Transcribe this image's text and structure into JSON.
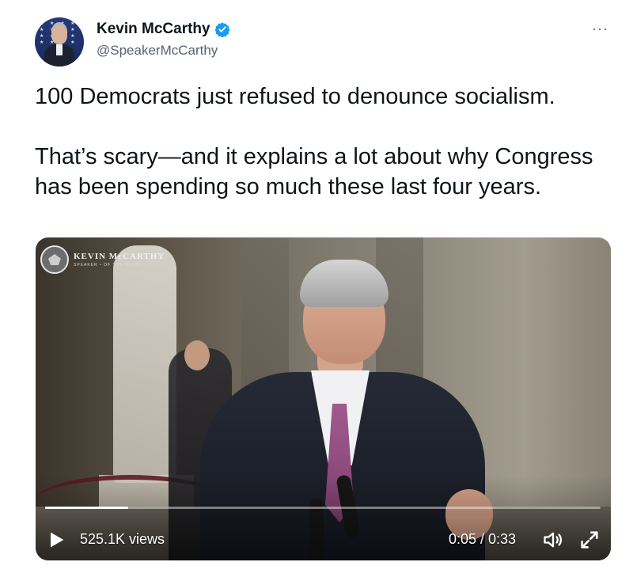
{
  "author": {
    "name": "Kevin McCarthy",
    "handle": "@SpeakerMcCarthy",
    "verified": true,
    "avatar_icon": "avatar"
  },
  "more_label": "···",
  "tweet": {
    "text": "100 Democrats just refused to denounce socialism.\n\nThat’s scary—and it explains a lot about why Congress has been spending so much these last four years."
  },
  "video": {
    "logo_text": "KEVIN McCARTHY",
    "logo_subtext": "SPEAKER • OF THE HOUSE",
    "views_label": "525.1K views",
    "time_label": "0:05 / 0:33",
    "progress_fraction": 0.15,
    "icons": [
      "play-icon",
      "volume-icon",
      "fullscreen-icon"
    ]
  },
  "colors": {
    "verified_blue": "#1d9bf0",
    "text_primary": "#0f1419",
    "text_secondary": "#536471"
  }
}
